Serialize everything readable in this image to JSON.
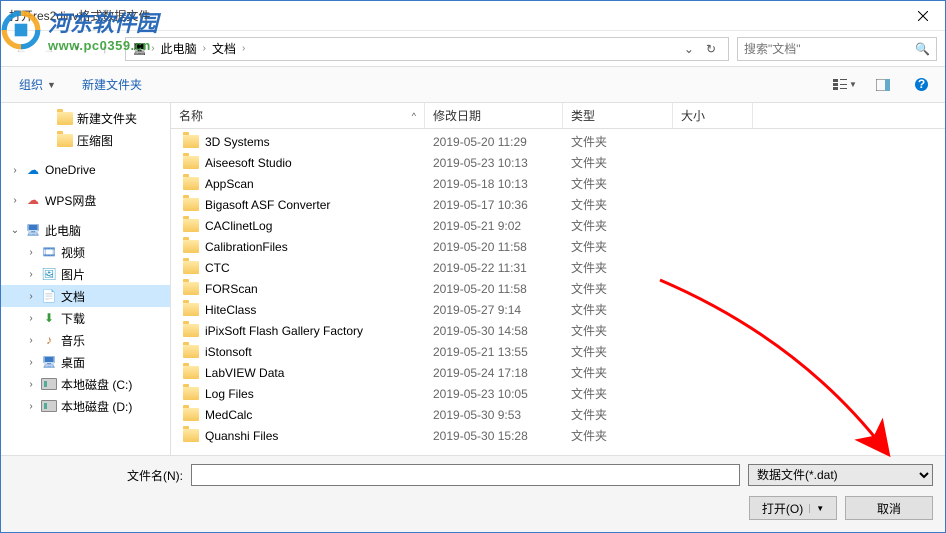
{
  "title": "打开res2dinv格式数据文件",
  "watermark": {
    "cn": "河东软件园",
    "url": "www.pc0359.cn"
  },
  "breadcrumb": {
    "items": [
      "此电脑",
      "文档"
    ]
  },
  "search": {
    "placeholder": "搜索\"文档\""
  },
  "toolbar": {
    "organize": "组织",
    "newfolder": "新建文件夹"
  },
  "columns": {
    "name": "名称",
    "date": "修改日期",
    "type": "类型",
    "size": "大小"
  },
  "tree": [
    {
      "label": "新建文件夹",
      "icon": "folder",
      "indent": 2,
      "chev": ""
    },
    {
      "label": "压缩图",
      "icon": "folder",
      "indent": 2,
      "chev": ""
    },
    {
      "label": "",
      "icon": "",
      "indent": 0,
      "chev": ""
    },
    {
      "label": "OneDrive",
      "icon": "onedrive",
      "indent": 0,
      "chev": "›"
    },
    {
      "label": "",
      "icon": "",
      "indent": 0,
      "chev": ""
    },
    {
      "label": "WPS网盘",
      "icon": "wps",
      "indent": 0,
      "chev": "›"
    },
    {
      "label": "",
      "icon": "",
      "indent": 0,
      "chev": ""
    },
    {
      "label": "此电脑",
      "icon": "pc",
      "indent": 0,
      "chev": "⌄"
    },
    {
      "label": "视频",
      "icon": "video",
      "indent": 1,
      "chev": "›"
    },
    {
      "label": "图片",
      "icon": "pic",
      "indent": 1,
      "chev": "›"
    },
    {
      "label": "文档",
      "icon": "doc",
      "indent": 1,
      "chev": "›",
      "selected": true
    },
    {
      "label": "下载",
      "icon": "dl",
      "indent": 1,
      "chev": "›"
    },
    {
      "label": "音乐",
      "icon": "music",
      "indent": 1,
      "chev": "›"
    },
    {
      "label": "桌面",
      "icon": "desk",
      "indent": 1,
      "chev": "›"
    },
    {
      "label": "本地磁盘 (C:)",
      "icon": "disk",
      "indent": 1,
      "chev": "›"
    },
    {
      "label": "本地磁盘 (D:)",
      "icon": "disk",
      "indent": 1,
      "chev": "›"
    }
  ],
  "files": [
    {
      "name": "3D Systems",
      "date": "2019-05-20 11:29",
      "type": "文件夹"
    },
    {
      "name": "Aiseesoft Studio",
      "date": "2019-05-23 10:13",
      "type": "文件夹"
    },
    {
      "name": "AppScan",
      "date": "2019-05-18 10:13",
      "type": "文件夹"
    },
    {
      "name": "Bigasoft ASF Converter",
      "date": "2019-05-17 10:36",
      "type": "文件夹"
    },
    {
      "name": "CAClinetLog",
      "date": "2019-05-21 9:02",
      "type": "文件夹"
    },
    {
      "name": "CalibrationFiles",
      "date": "2019-05-20 11:58",
      "type": "文件夹"
    },
    {
      "name": "CTC",
      "date": "2019-05-22 11:31",
      "type": "文件夹"
    },
    {
      "name": "FORScan",
      "date": "2019-05-20 11:58",
      "type": "文件夹"
    },
    {
      "name": "HiteClass",
      "date": "2019-05-27 9:14",
      "type": "文件夹"
    },
    {
      "name": "iPixSoft Flash Gallery Factory",
      "date": "2019-05-30 14:58",
      "type": "文件夹"
    },
    {
      "name": "iStonsoft",
      "date": "2019-05-21 13:55",
      "type": "文件夹"
    },
    {
      "name": "LabVIEW Data",
      "date": "2019-05-24 17:18",
      "type": "文件夹"
    },
    {
      "name": "Log Files",
      "date": "2019-05-23 10:05",
      "type": "文件夹"
    },
    {
      "name": "MedCalc",
      "date": "2019-05-30 9:53",
      "type": "文件夹"
    },
    {
      "name": "Quanshi Files",
      "date": "2019-05-30 15:28",
      "type": "文件夹"
    }
  ],
  "bottom": {
    "filename_label": "文件名(N):",
    "filename_value": "",
    "filter": "数据文件(*.dat)",
    "open": "打开(O)",
    "cancel": "取消"
  }
}
